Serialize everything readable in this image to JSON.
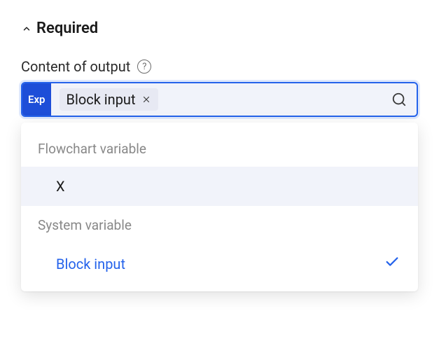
{
  "section": {
    "title": "Required",
    "expanded": true
  },
  "field": {
    "label": "Content of output",
    "help_tooltip": "?",
    "badge": "Exp",
    "token": {
      "label": "Block input"
    }
  },
  "dropdown": {
    "groups": [
      {
        "label": "Flowchart variable",
        "options": [
          {
            "label": "X",
            "selected": false,
            "highlighted": true
          }
        ]
      },
      {
        "label": "System variable",
        "options": [
          {
            "label": "Block input",
            "selected": true,
            "highlighted": false
          }
        ]
      }
    ]
  }
}
